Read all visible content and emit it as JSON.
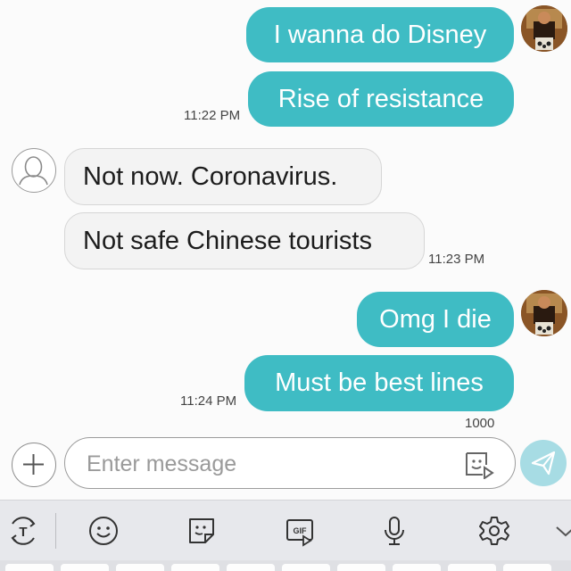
{
  "messages": [
    {
      "direction": "outgoing",
      "text": "I wanna do Disney"
    },
    {
      "direction": "outgoing",
      "text": "Rise of resistance",
      "time": "11:22 PM"
    },
    {
      "direction": "incoming",
      "text": "Not now. Coronavirus."
    },
    {
      "direction": "incoming",
      "text": "Not safe Chinese tourists",
      "time": "11:23 PM"
    },
    {
      "direction": "outgoing",
      "text": "Omg I die"
    },
    {
      "direction": "outgoing",
      "text": "Must be best lines",
      "time": "11:24 PM"
    }
  ],
  "composer": {
    "char_counter": "1000",
    "placeholder": "Enter message",
    "value": ""
  },
  "colors": {
    "outgoing_bubble": "#3fbcc4",
    "incoming_bubble": "#f3f3f3",
    "send_button": "#a7dce4",
    "toolbar_bg": "#e7e8ec"
  },
  "toolbar_icons": [
    "translate-icon",
    "emoji-icon",
    "sticker-icon",
    "gif-icon",
    "microphone-icon",
    "settings-icon",
    "collapse-chevron-icon"
  ],
  "gif_label": "GIF",
  "translate_label": "T"
}
